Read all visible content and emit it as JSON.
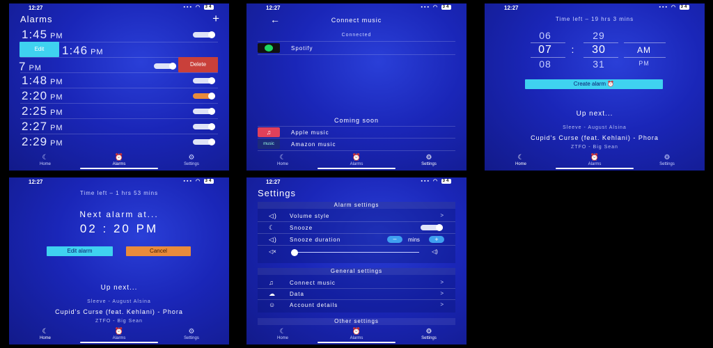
{
  "status": {
    "time": "12:27",
    "signal": "▪▪▪",
    "wifi": "◠",
    "battery": "34"
  },
  "tabs": {
    "home": "Home",
    "alarms": "Alarms",
    "settings": "Settings"
  },
  "alarms_screen": {
    "title": "Alarms",
    "add": "+",
    "edit": "Edit",
    "delete": "Delete",
    "partial_time": "7",
    "alarms": [
      {
        "time": "1:45",
        "ampm": "PM"
      },
      {
        "time": "1:46",
        "ampm": "PM"
      },
      {
        "time": "",
        "ampm": "PM"
      },
      {
        "time": "1:48",
        "ampm": "PM"
      },
      {
        "time": "2:20",
        "ampm": "PM"
      },
      {
        "time": "2:25",
        "ampm": "PM"
      },
      {
        "time": "2:27",
        "ampm": "PM"
      },
      {
        "time": "2:29",
        "ampm": "PM"
      }
    ]
  },
  "music_screen": {
    "back": "←",
    "title": "Connect music",
    "connected": "Connected",
    "spotify": "Spotify",
    "coming_soon": "Coming soon",
    "apple": "Apple music",
    "amazon": "Amazon music",
    "amazon_logo": "music"
  },
  "picker_screen": {
    "time_left": "Time left – 19 hrs 3 mins",
    "hours": [
      "06",
      "07",
      "08"
    ],
    "minutes": [
      "29",
      "30",
      "31"
    ],
    "colon": ":",
    "am": "AM",
    "pm": "PM",
    "create": "Create alarm",
    "up_next": "Up next...",
    "song1": "Sleeve - August Alsina",
    "song2": "Cupid's Curse (feat. Kehlani) - Phora",
    "song3": "ZTFO - Big Sean"
  },
  "home_screen": {
    "time_left": "Time left – 1 hrs 53 mins",
    "next_alarm": "Next alarm at...",
    "alarm_time": "02 : 20 PM",
    "edit": "Edit alarm",
    "cancel": "Cancel",
    "up_next": "Up next...",
    "song1": "Sleeve - August Alsina",
    "song2": "Cupid's Curse (feat. Kehlani) - Phora",
    "song3": "ZTFO - Big Sean"
  },
  "settings_screen": {
    "title": "Settings",
    "alarm_settings": "Alarm settings",
    "volume_style": "Volume style",
    "snooze": "Snooze",
    "snooze_duration": "Snooze duration",
    "mins": "mins",
    "general_settings": "General settings",
    "connect_music": "Connect music",
    "data": "Data",
    "account": "Account details",
    "other_settings": "Other settings",
    "chevron": ">"
  },
  "colors": {
    "bg": "#1a26b8",
    "accent": "#3fd2f0",
    "orange": "#e98b3b",
    "delete": "#c9403a"
  }
}
